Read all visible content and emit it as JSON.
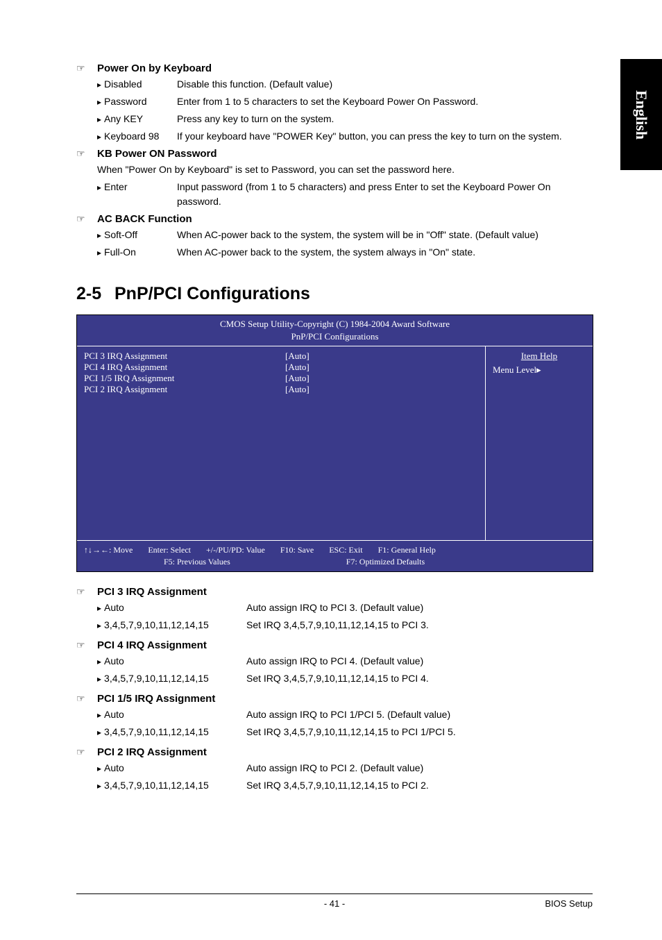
{
  "side_tab": "English",
  "items": [
    {
      "title": "Power On by Keyboard",
      "options": [
        {
          "label": "Disabled",
          "desc": "Disable this function. (Default value)"
        },
        {
          "label": "Password",
          "desc": "Enter from 1 to 5 characters to set the Keyboard Power On Password."
        },
        {
          "label": "Any KEY",
          "desc": "Press any key to turn on the system."
        },
        {
          "label": "Keyboard 98",
          "desc": "If your keyboard have \"POWER Key\" button, you can press the key to turn on the system."
        }
      ]
    },
    {
      "title": "KB Power ON Password",
      "note": "When \"Power On by Keyboard\" is set to Password, you can set the password here.",
      "options": [
        {
          "label": "Enter",
          "desc": "Input password (from 1 to 5 characters) and press Enter to set the Keyboard Power On password."
        }
      ]
    },
    {
      "title": "AC BACK Function",
      "options": [
        {
          "label": "Soft-Off",
          "desc": "When AC-power back to the system, the system will be in \"Off\" state. (Default value)"
        },
        {
          "label": "Full-On",
          "desc": "When AC-power back to the system, the system always in \"On\" state."
        }
      ]
    }
  ],
  "section": {
    "num": "2-5",
    "title": "PnP/PCI Configurations"
  },
  "bios": {
    "header1": "CMOS Setup Utility-Copyright (C) 1984-2004 Award Software",
    "header2": "PnP/PCI Configurations",
    "rows": [
      {
        "label": "PCI 3 IRQ Assignment",
        "value": "[Auto]"
      },
      {
        "label": "PCI 4 IRQ Assignment",
        "value": "[Auto]"
      },
      {
        "label": "PCI 1/5 IRQ Assignment",
        "value": "[Auto]"
      },
      {
        "label": "PCI 2 IRQ Assignment",
        "value": "[Auto]"
      }
    ],
    "help_title": "Item Help",
    "menu_level": "Menu Level",
    "footer": {
      "move": "↑↓→←: Move",
      "enter": "Enter: Select",
      "pupd": "+/-/PU/PD: Value",
      "f10": "F10: Save",
      "esc": "ESC: Exit",
      "f1": "F1: General Help",
      "f5": "F5: Previous Values",
      "f7": "F7: Optimized Defaults"
    }
  },
  "assignments": [
    {
      "title": "PCI 3 IRQ Assignment",
      "rows": [
        {
          "opt": "Auto",
          "desc": "Auto assign IRQ to PCI 3. (Default value)"
        },
        {
          "opt": "3,4,5,7,9,10,11,12,14,15",
          "desc": "Set IRQ 3,4,5,7,9,10,11,12,14,15 to PCI 3."
        }
      ]
    },
    {
      "title": "PCI 4 IRQ Assignment",
      "rows": [
        {
          "opt": "Auto",
          "desc": "Auto assign IRQ to PCI 4. (Default value)"
        },
        {
          "opt": "3,4,5,7,9,10,11,12,14,15",
          "desc": "Set IRQ 3,4,5,7,9,10,11,12,14,15 to PCI 4."
        }
      ]
    },
    {
      "title": "PCI 1/5 IRQ Assignment",
      "rows": [
        {
          "opt": "Auto",
          "desc": "Auto assign IRQ to PCI 1/PCI 5. (Default value)"
        },
        {
          "opt": "3,4,5,7,9,10,11,12,14,15",
          "desc": "Set IRQ 3,4,5,7,9,10,11,12,14,15 to PCI 1/PCI 5."
        }
      ]
    },
    {
      "title": "PCI 2 IRQ Assignment",
      "rows": [
        {
          "opt": "Auto",
          "desc": "Auto assign IRQ to PCI 2. (Default value)"
        },
        {
          "opt": "3,4,5,7,9,10,11,12,14,15",
          "desc": "Set IRQ 3,4,5,7,9,10,11,12,14,15 to PCI 2."
        }
      ]
    }
  ],
  "footer": {
    "page": "- 41 -",
    "right": "BIOS Setup"
  }
}
